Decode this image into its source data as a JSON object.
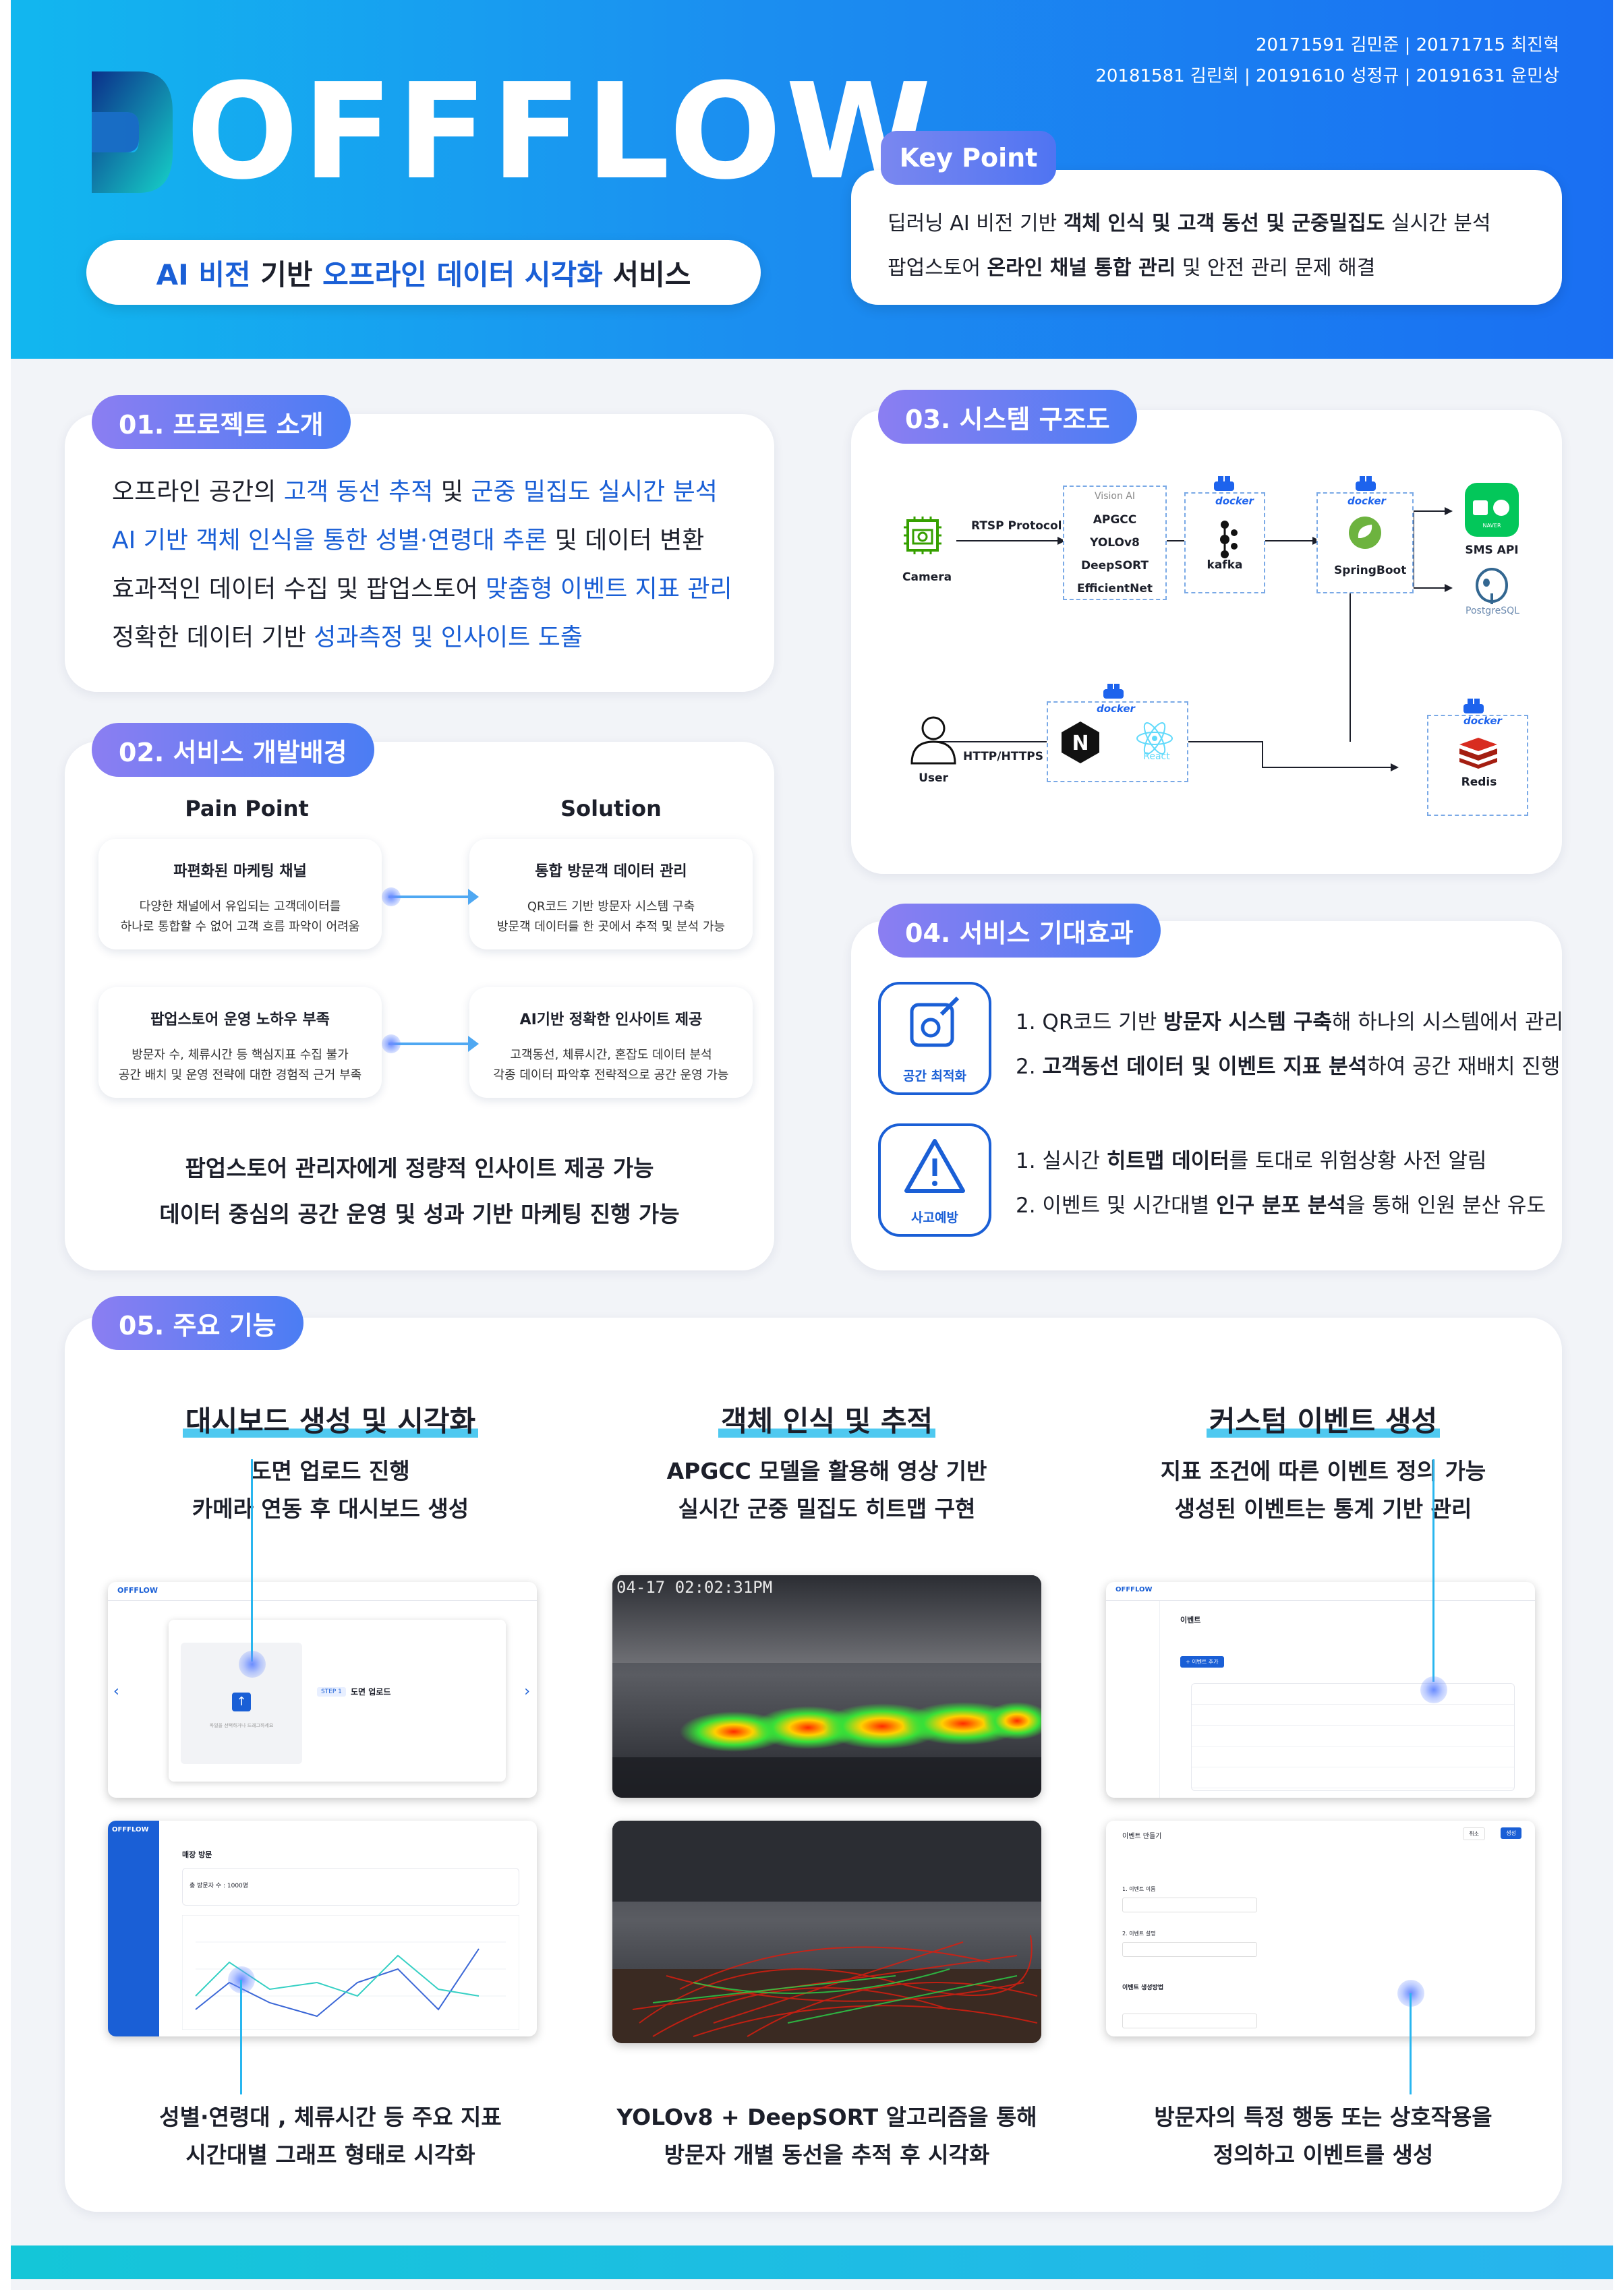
{
  "header": {
    "members_line1": "20171591 김민준 | 20171715 최진혁",
    "members_line2": "20181581 김린회 | 20191610 성정규 | 20191631 윤민상",
    "logo_text": "OFFFLOW",
    "subtitle_pre": "AI 비전 ",
    "subtitle_mid1": "기반 ",
    "subtitle_hl": "오프라인 데이터 시각화",
    "subtitle_post": " 서비스",
    "key_point_label": "Key Point",
    "key_point_lines": [
      {
        "pre": "딥러닝 AI 비전 기반 ",
        "bold": "객체 인식 및 고객 동선 및 군중밀집도",
        "post": " 실시간 분석"
      },
      {
        "pre": "팝업스토어 ",
        "bold": "온라인 채널 통합 관리",
        "post": " 및 안전 관리 문제 해결"
      }
    ]
  },
  "intro": {
    "tag": "01. 프로젝트 소개",
    "lines": [
      {
        "a": "오프라인 공간의 ",
        "b": "고객 동선 추적",
        "c": " 및 ",
        "d": "군중 밀집도 실시간 분석",
        "e": ""
      },
      {
        "a": "",
        "b": "AI 기반 객체 인식을 통한 성별·연령대 추론",
        "c": " 및 데이터 변환",
        "d": "",
        "e": ""
      },
      {
        "a": "효과적인 데이터 수집 및 팝업스토어 ",
        "b": "맞춤형 이벤트 지표 관리",
        "c": "",
        "d": "",
        "e": ""
      },
      {
        "a": "정확한 데이터 기반 ",
        "b": "성과측정 및 인사이트 도출",
        "c": "",
        "d": "",
        "e": ""
      }
    ]
  },
  "background": {
    "tag": "02. 서비스 개발배경",
    "pain_head": "Pain Point",
    "sol_head": "Solution",
    "rows": [
      {
        "pain_title": "파편화된 마케팅 채널",
        "pain_desc1": "다양한 채널에서 유입되는 고객데이터를",
        "pain_desc2": "하나로 통합할 수 없어 고객 흐름 파악이 어려움",
        "sol_title": "통합 방문객 데이터 관리",
        "sol_desc1": "QR코드 기반 방문자 시스템 구축",
        "sol_desc2": "방문객 데이터를 한 곳에서 추적 및 분석 가능"
      },
      {
        "pain_title": "팝업스토어 운영 노하우 부족",
        "pain_desc1": "방문자 수, 체류시간 등 핵심지표 수집 불가",
        "pain_desc2": "공간 배치 및 운영 전략에 대한 경험적 근거 부족",
        "sol_title": "AI기반 정확한 인사이트 제공",
        "sol_desc1": "고객동선, 체류시간, 혼잡도 데이터 분석",
        "sol_desc2": "각종 데이터 파악후 전략적으로 공간 운영 가능"
      }
    ],
    "summary1": "팝업스토어 관리자에게 정량적 인사이트 제공 가능",
    "summary2": "데이터 중심의 공간 운영 및 성과 기반 마케팅 진행 가능"
  },
  "system": {
    "tag": "03. 시스템 구조도",
    "camera": "Camera",
    "rtsp": "RTSP Protocol",
    "vision_label": "Vision AI",
    "vision_items": [
      "APGCC",
      "YOLOv8",
      "DeepSORT",
      "EfficientNet"
    ],
    "kafka": "kafka",
    "springboot": "SpringBoot",
    "sms": "SMS API",
    "naver_label": "NAVER CLOUD PLATFORM",
    "postgres": "PostgreSQL",
    "user": "User",
    "http": "HTTP/HTTPS",
    "react": "React",
    "redis": "Redis",
    "docker": "docker"
  },
  "effects": {
    "tag": "04. 서비스 기대효과",
    "icon1_label": "공간 최적화",
    "icon2_label": "사고예방",
    "group1": [
      {
        "pre": "1. QR코드 기반 ",
        "bold": "방문자 시스템 구축",
        "post": "해 하나의 시스템에서 관리"
      },
      {
        "pre": "2. ",
        "bold": "고객동선 데이터 및 이벤트 지표 분석",
        "post": "하여 공간 재배치 진행"
      }
    ],
    "group2": [
      {
        "pre": "1. 실시간 ",
        "bold": "히트맵 데이터",
        "post": "를 토대로 위험상황 사전 알림"
      },
      {
        "pre": "2. 이벤트 및 시간대별 ",
        "bold": "인구 분포 분석",
        "post": "을 통해 인원 분산 유도"
      }
    ]
  },
  "features": {
    "tag": "05. 주요 기능",
    "items": [
      {
        "title": "대시보드 생성 및 시각화",
        "desc1": "도면 업로드 진행",
        "desc2": "카메라 연동 후 대시보드 생성",
        "foot1": "성별·연령대 , 체류시간 등 주요 지표",
        "foot2": "시간대별 그래프 형태로 시각화"
      },
      {
        "title": "객체 인식 및 추적",
        "desc1": "APGCC 모델을 활용해 영상 기반",
        "desc2": "실시간 군중 밀집도 히트맵 구현",
        "foot1": "YOLOv8 + DeepSORT 알고리즘을 통해",
        "foot2": "방문자 개별 동선을 추적 후 시각화"
      },
      {
        "title": "커스텀 이벤트 생성",
        "desc1": "지표 조건에 따른 이벤트 정의 가능",
        "desc2": "생성된 이벤트는 통계 기반 관리",
        "foot1": "방문자의 특정 행동 또는 상호작용을",
        "foot2": "정의하고 이벤트를 생성"
      }
    ],
    "shot_upload": {
      "logo": "OFFFLOW",
      "step": "STEP 1",
      "title": "도면 업로드",
      "desc": "파일을 선택하거나 드래그하세요"
    },
    "shot_dashboard": {
      "logo": "OFFFLOW",
      "title": "매장 방문",
      "metric": "총 방문자 수 : 1000명"
    },
    "heatmap_timestamp": "04-17 02:02:31PM",
    "shot_events": {
      "logo": "OFFFLOW",
      "title": "이벤트",
      "button": "+ 이벤트 추가"
    },
    "shot_event_form": {
      "title": "이벤트 만들기",
      "field1": "1. 이벤트 이름",
      "field2": "2. 이벤트 설명",
      "section": "이벤트 생성방법",
      "cancel": "취소",
      "create": "생성"
    }
  },
  "colors": {
    "accent": "#1a5fd6",
    "header_start": "#12b7ef",
    "header_end": "#1a6ff2",
    "tag_start": "#8b7ef2",
    "tag_end": "#4b7df3",
    "bar": "#14c6d8"
  }
}
